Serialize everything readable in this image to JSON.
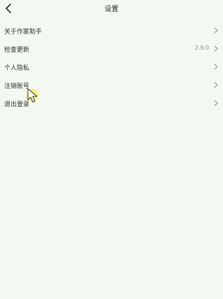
{
  "header": {
    "title": "设置",
    "back_icon": "chevron-left-icon"
  },
  "settings": {
    "items": [
      {
        "label": "关于作家助手",
        "value": ""
      },
      {
        "label": "检查更新",
        "value": "2.9.0"
      },
      {
        "label": "个人隐私",
        "value": ""
      },
      {
        "label": "注销账号",
        "value": ""
      },
      {
        "label": "退出登录",
        "value": ""
      }
    ]
  },
  "colors": {
    "background": "#f3f8f3",
    "text": "#2a2a2a",
    "secondary_text": "#8a8a8a",
    "cursor_fill": "#f2ec3a"
  }
}
